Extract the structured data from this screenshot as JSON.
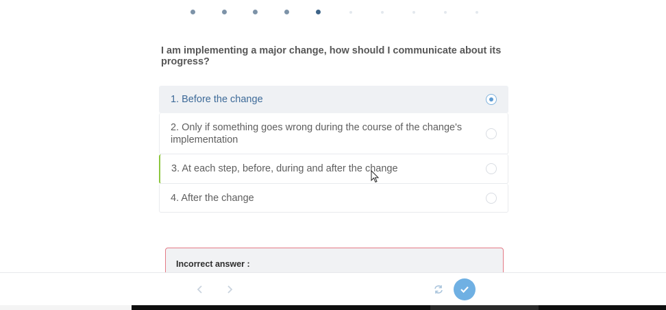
{
  "progress": {
    "dots": [
      "done",
      "done",
      "done",
      "done",
      "current",
      "todo",
      "todo",
      "todo",
      "todo",
      "todo"
    ]
  },
  "question": {
    "text": "I am implementing a major change, how should I communicate about its progress?"
  },
  "answers": [
    {
      "label": "1. Before the change",
      "selected": true
    },
    {
      "label": "2. Only if something goes wrong during the course of the change's implementation",
      "selected": false
    },
    {
      "label": "3. At each step, before, during and after the change",
      "selected": false
    },
    {
      "label": "4. After the change",
      "selected": false
    }
  ],
  "feedback": {
    "title": "Incorrect answer :"
  },
  "colors": {
    "accent": "#5d9bd3",
    "correct_marker": "#8cc63f",
    "error_border": "#e47884"
  },
  "icons": {
    "previous": "chevron-left-icon",
    "next": "chevron-right-icon",
    "reset": "refresh-icon",
    "submit": "check-icon"
  }
}
